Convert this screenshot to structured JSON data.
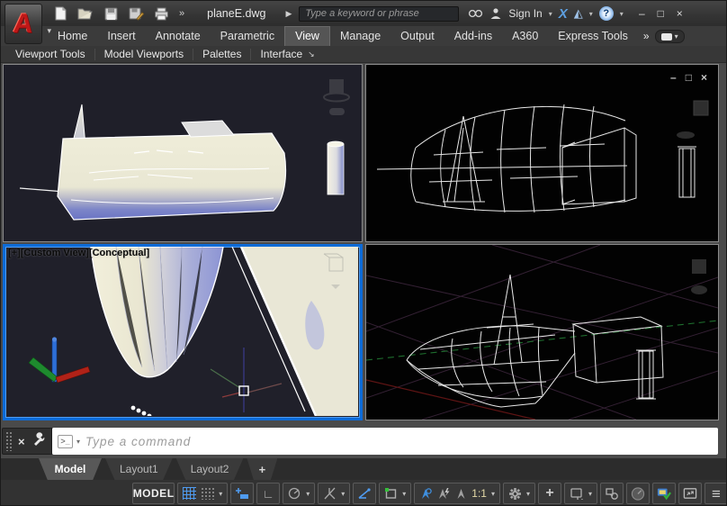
{
  "titlebar": {
    "filename": "planeE.dwg",
    "search_placeholder": "Type a keyword or phrase",
    "sign_in_label": "Sign In"
  },
  "icons": {
    "logo_letter": "A",
    "caret_down": "▾",
    "qat_expand": "»",
    "file_flyout": "▶",
    "exchange_x": "X",
    "a360_glyph": "◭",
    "help_glyph": "?",
    "win_minimize": "–",
    "win_maximize": "□",
    "win_close": "×",
    "tabs_expand": "»",
    "panel_arrow": "↘",
    "vp_minimize": "–",
    "vp_restore": "□",
    "vp_close": "×",
    "cmd_close": "×",
    "cmd_prompt": ">_",
    "plus": "+",
    "hamburger": "≡",
    "ortho": "∟"
  },
  "ribbon": {
    "tabs": [
      "Home",
      "Insert",
      "Annotate",
      "Parametric",
      "View",
      "Manage",
      "Output",
      "Add-ins",
      "A360",
      "Express Tools"
    ],
    "active_tab": "View",
    "panels": [
      "Viewport Tools",
      "Model Viewports",
      "Palettes",
      "Interface"
    ]
  },
  "viewport": {
    "label_plus": "[+]",
    "label_view": "[Custom View]",
    "label_style": "[Conceptual]",
    "ucs": {
      "x": "X",
      "y": "Y",
      "z": "Z"
    }
  },
  "command_line": {
    "placeholder": "Type a command"
  },
  "layout_tabs": {
    "items": [
      "Model",
      "Layout1",
      "Layout2"
    ],
    "active": "Model",
    "add_label": "+"
  },
  "status_bar": {
    "model_toggle": "MODEL",
    "annotation_scale": "1:1"
  },
  "colors": {
    "active_viewport_border": "#0d6bd8",
    "accent_blue": "#4f9bef",
    "logo_red": "#c01818",
    "ucs_x_red": "#c0392b",
    "ucs_y_green": "#1e8a2e",
    "ucs_z_blue": "#2e6fd8",
    "wireframe": "#e8e8e8",
    "shaded_cream": "#efeddb",
    "shaded_blue": "#7d86c8"
  }
}
